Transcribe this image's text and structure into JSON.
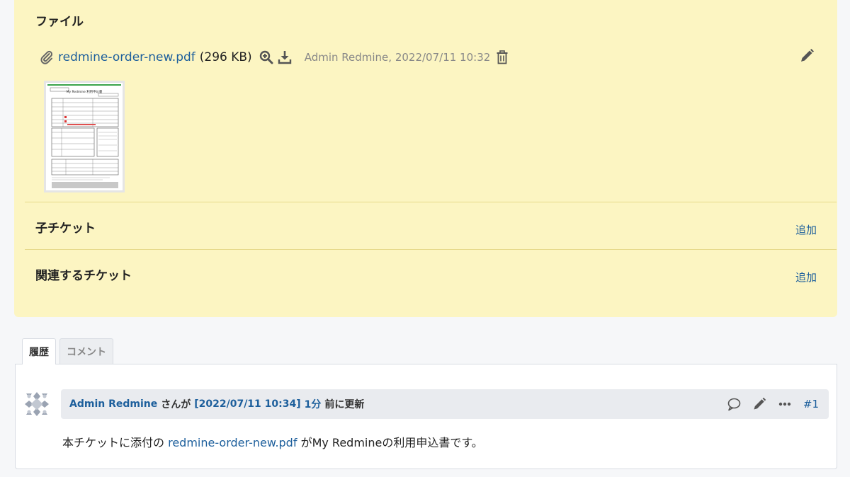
{
  "issue": {
    "files_title": "ファイル",
    "attachment": {
      "filename": "redmine-order-new.pdf",
      "size": "(296 KB)",
      "author_time": "Admin Redmine, 2022/07/11 10:32",
      "icons": [
        "paperclip-icon",
        "magnifier-plus-icon",
        "download-icon",
        "trash-icon",
        "pencil-icon"
      ]
    },
    "thumbnail": {
      "doc_title": "My Redmine 利用申込書"
    },
    "subtasks_title": "子チケット",
    "subtasks_add": "追加",
    "related_title": "関連するチケット",
    "related_add": "追加"
  },
  "tabs": [
    {
      "label": "履歴",
      "active": true
    },
    {
      "label": "コメント",
      "active": false
    }
  ],
  "journal": {
    "author": "Admin Redmine",
    "by_text": "さんが",
    "timestamp": "[2022/07/11 10:34]",
    "ago": "1分",
    "updated_text": "前に更新",
    "number": "#1",
    "body_prefix": "本チケットに添付の",
    "body_file": "redmine-order-new.pdf",
    "body_suffix": "がMy Redmineの利用申込書です。"
  },
  "colors": {
    "panel_bg": "#fcf5c2",
    "link": "#1d5f9c",
    "journal_header_bg": "#e9ebef"
  }
}
